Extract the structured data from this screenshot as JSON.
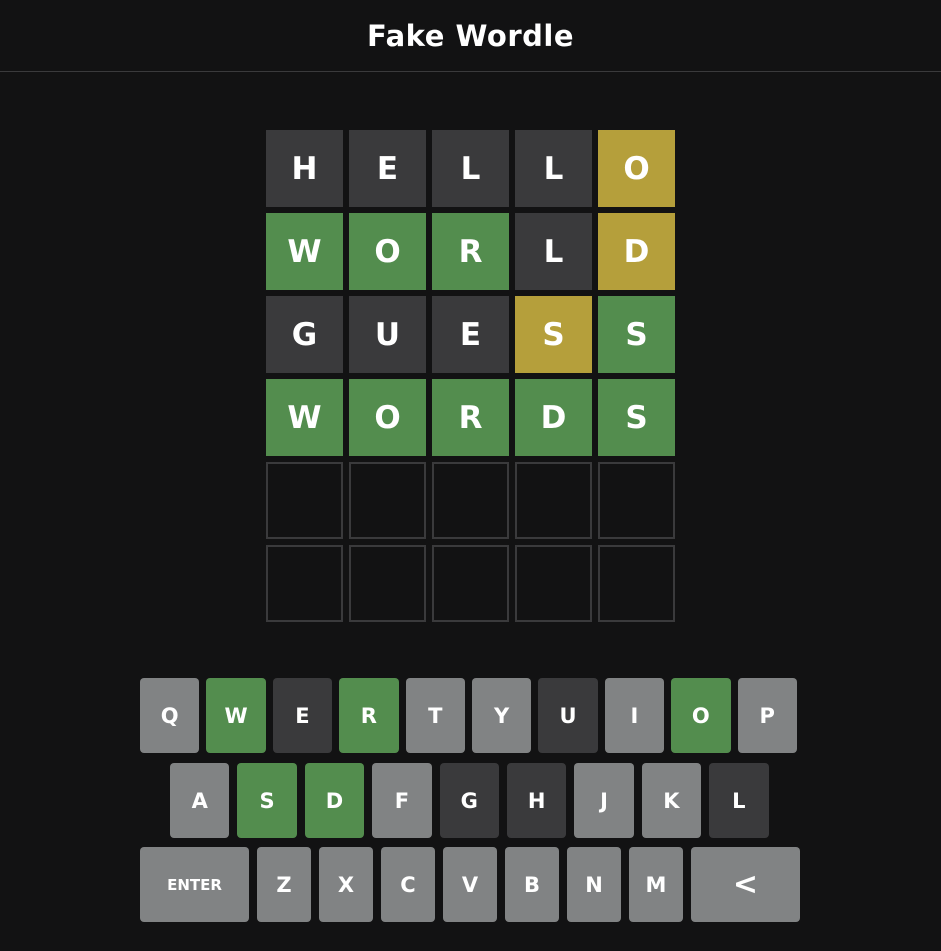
{
  "header": {
    "title": "Fake Wordle"
  },
  "board": {
    "rows": [
      [
        {
          "letter": "H",
          "state": "absent"
        },
        {
          "letter": "E",
          "state": "absent"
        },
        {
          "letter": "L",
          "state": "absent"
        },
        {
          "letter": "L",
          "state": "absent"
        },
        {
          "letter": "O",
          "state": "present"
        }
      ],
      [
        {
          "letter": "W",
          "state": "correct"
        },
        {
          "letter": "O",
          "state": "correct"
        },
        {
          "letter": "R",
          "state": "correct"
        },
        {
          "letter": "L",
          "state": "absent"
        },
        {
          "letter": "D",
          "state": "present"
        }
      ],
      [
        {
          "letter": "G",
          "state": "absent"
        },
        {
          "letter": "U",
          "state": "absent"
        },
        {
          "letter": "E",
          "state": "absent"
        },
        {
          "letter": "S",
          "state": "present"
        },
        {
          "letter": "S",
          "state": "correct"
        }
      ],
      [
        {
          "letter": "W",
          "state": "correct"
        },
        {
          "letter": "O",
          "state": "correct"
        },
        {
          "letter": "R",
          "state": "correct"
        },
        {
          "letter": "D",
          "state": "correct"
        },
        {
          "letter": "S",
          "state": "correct"
        }
      ],
      [
        {
          "letter": "",
          "state": "empty"
        },
        {
          "letter": "",
          "state": "empty"
        },
        {
          "letter": "",
          "state": "empty"
        },
        {
          "letter": "",
          "state": "empty"
        },
        {
          "letter": "",
          "state": "empty"
        }
      ],
      [
        {
          "letter": "",
          "state": "empty"
        },
        {
          "letter": "",
          "state": "empty"
        },
        {
          "letter": "",
          "state": "empty"
        },
        {
          "letter": "",
          "state": "empty"
        },
        {
          "letter": "",
          "state": "empty"
        }
      ]
    ]
  },
  "keyboard": {
    "rows": [
      [
        {
          "label": "Q",
          "state": "unused"
        },
        {
          "label": "W",
          "state": "correct"
        },
        {
          "label": "E",
          "state": "absent"
        },
        {
          "label": "R",
          "state": "correct"
        },
        {
          "label": "T",
          "state": "unused"
        },
        {
          "label": "Y",
          "state": "unused"
        },
        {
          "label": "U",
          "state": "absent"
        },
        {
          "label": "I",
          "state": "unused"
        },
        {
          "label": "O",
          "state": "correct"
        },
        {
          "label": "P",
          "state": "unused"
        }
      ],
      [
        {
          "label": "A",
          "state": "unused"
        },
        {
          "label": "S",
          "state": "correct"
        },
        {
          "label": "D",
          "state": "correct"
        },
        {
          "label": "F",
          "state": "unused"
        },
        {
          "label": "G",
          "state": "absent"
        },
        {
          "label": "H",
          "state": "absent"
        },
        {
          "label": "J",
          "state": "unused"
        },
        {
          "label": "K",
          "state": "unused"
        },
        {
          "label": "L",
          "state": "absent"
        }
      ],
      [
        {
          "label": "ENTER",
          "state": "unused",
          "kind": "enter"
        },
        {
          "label": "Z",
          "state": "unused"
        },
        {
          "label": "X",
          "state": "unused"
        },
        {
          "label": "C",
          "state": "unused"
        },
        {
          "label": "V",
          "state": "unused"
        },
        {
          "label": "B",
          "state": "unused"
        },
        {
          "label": "N",
          "state": "unused"
        },
        {
          "label": "M",
          "state": "unused"
        },
        {
          "label": "<",
          "state": "unused",
          "kind": "backspace"
        }
      ]
    ]
  },
  "colors": {
    "background": "#121213",
    "absent": "#3a3a3c",
    "present": "#b59f3b",
    "correct": "#538d4e",
    "unused_key": "#818384"
  }
}
